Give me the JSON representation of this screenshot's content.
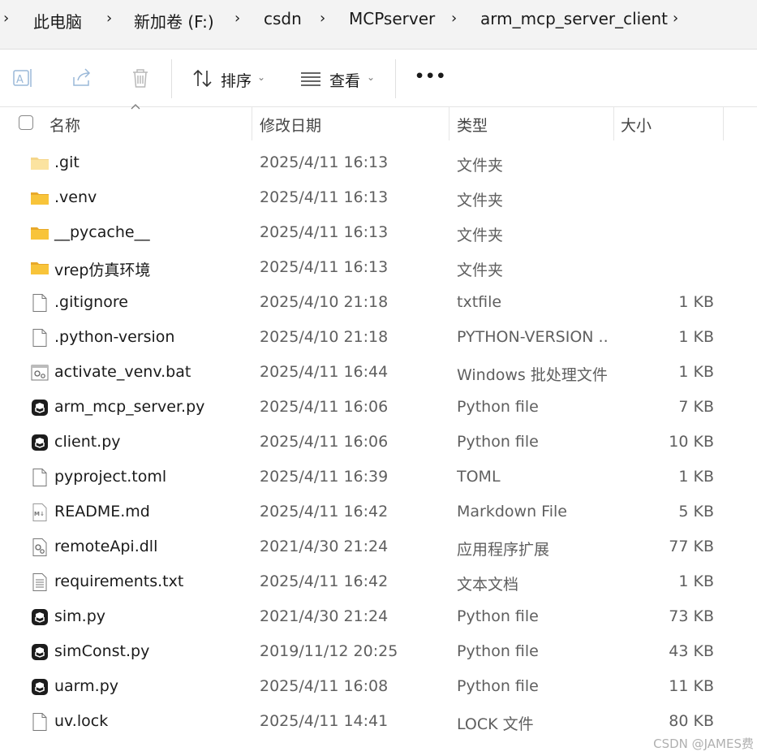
{
  "breadcrumb": {
    "items": [
      "此电脑",
      "新加卷 (F:)",
      "csdn",
      "MCPserver",
      "arm_mcp_server_client"
    ]
  },
  "toolbar": {
    "sort_label": "排序",
    "view_label": "查看",
    "more_label": "•••"
  },
  "columns": {
    "name": "名称",
    "date": "修改日期",
    "type": "类型",
    "size": "大小"
  },
  "files": [
    {
      "name": ".git",
      "date": "2025/4/11 16:13",
      "type": "文件夹",
      "size": "",
      "icon": "folder-faded-icon"
    },
    {
      "name": ".venv",
      "date": "2025/4/11 16:13",
      "type": "文件夹",
      "size": "",
      "icon": "folder-icon"
    },
    {
      "name": "__pycache__",
      "date": "2025/4/11 16:13",
      "type": "文件夹",
      "size": "",
      "icon": "folder-icon"
    },
    {
      "name": "vrep仿真环境",
      "date": "2025/4/11 16:13",
      "type": "文件夹",
      "size": "",
      "icon": "folder-icon"
    },
    {
      "name": ".gitignore",
      "date": "2025/4/10 21:18",
      "type": "txtfile",
      "size": "1 KB",
      "icon": "blank-file-icon"
    },
    {
      "name": ".python-version",
      "date": "2025/4/10 21:18",
      "type": "PYTHON-VERSION ...",
      "size": "1 KB",
      "icon": "blank-file-icon"
    },
    {
      "name": "activate_venv.bat",
      "date": "2025/4/11 16:44",
      "type": "Windows 批处理文件",
      "size": "1 KB",
      "icon": "batch-file-icon"
    },
    {
      "name": "arm_mcp_server.py",
      "date": "2025/4/11 16:06",
      "type": "Python file",
      "size": "7 KB",
      "icon": "python-file-icon"
    },
    {
      "name": "client.py",
      "date": "2025/4/11 16:06",
      "type": "Python file",
      "size": "10 KB",
      "icon": "python-file-icon"
    },
    {
      "name": "pyproject.toml",
      "date": "2025/4/11 16:39",
      "type": "TOML",
      "size": "1 KB",
      "icon": "blank-file-icon"
    },
    {
      "name": "README.md",
      "date": "2025/4/11 16:42",
      "type": "Markdown File",
      "size": "5 KB",
      "icon": "markdown-file-icon"
    },
    {
      "name": "remoteApi.dll",
      "date": "2021/4/30 21:24",
      "type": "应用程序扩展",
      "size": "77 KB",
      "icon": "dll-file-icon"
    },
    {
      "name": "requirements.txt",
      "date": "2025/4/11 16:42",
      "type": "文本文档",
      "size": "1 KB",
      "icon": "text-file-icon"
    },
    {
      "name": "sim.py",
      "date": "2021/4/30 21:24",
      "type": "Python file",
      "size": "73 KB",
      "icon": "python-file-icon"
    },
    {
      "name": "simConst.py",
      "date": "2019/11/12 20:25",
      "type": "Python file",
      "size": "43 KB",
      "icon": "python-file-icon"
    },
    {
      "name": "uarm.py",
      "date": "2025/4/11 16:08",
      "type": "Python file",
      "size": "11 KB",
      "icon": "python-file-icon"
    },
    {
      "name": "uv.lock",
      "date": "2025/4/11 14:41",
      "type": "LOCK 文件",
      "size": "80 KB",
      "icon": "blank-file-icon"
    }
  ],
  "watermark": "CSDN @JAMES费",
  "colors": {
    "folder": "#f8c43a",
    "folder_faded": "#fbe3a0",
    "breadcrumb_bg": "#f3f3f3",
    "text_secondary": "#5f5f5f"
  }
}
